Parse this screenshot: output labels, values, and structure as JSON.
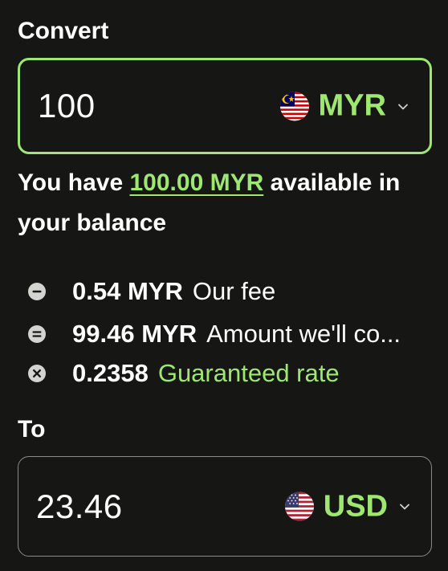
{
  "convert": {
    "label": "Convert",
    "amount": "100",
    "currency_code": "MYR",
    "flag_icon": "malaysia-flag-icon",
    "border_color": "#9fe870"
  },
  "balance": {
    "prefix": "You have",
    "amount_link": "100.00 MYR",
    "suffix": "available in your balance"
  },
  "breakdown": [
    {
      "icon": "minus-circle-icon",
      "value": "0.54 MYR",
      "description": "Our fee",
      "highlight": false
    },
    {
      "icon": "equals-circle-icon",
      "value": "99.46 MYR",
      "description": "Amount we'll co...",
      "highlight": false
    },
    {
      "icon": "multiply-circle-icon",
      "value": "0.2358",
      "description": "Guaranteed rate",
      "highlight": true
    }
  ],
  "to": {
    "label": "To",
    "amount": "23.46",
    "currency_code": "USD",
    "flag_icon": "usa-flag-icon"
  },
  "colors": {
    "background": "#161715",
    "accent": "#9fe870",
    "text": "#ffffff"
  }
}
